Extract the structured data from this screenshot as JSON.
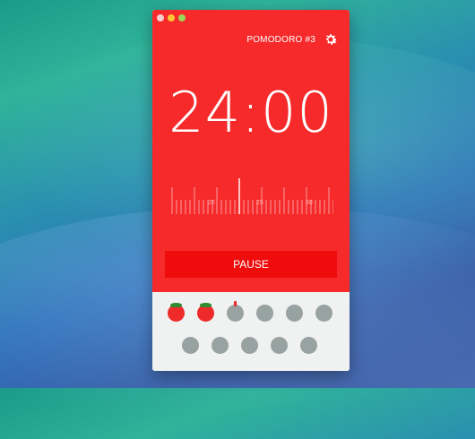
{
  "header": {
    "title": "POMODORO #3"
  },
  "timer": {
    "value": "24:00"
  },
  "ruler": {
    "labels": [
      "20",
      "25",
      "30"
    ]
  },
  "controls": {
    "pause_label": "PAUSE"
  },
  "pomodoros": {
    "row1": [
      "tomato",
      "tomato",
      "sprout",
      "empty",
      "empty",
      "empty"
    ],
    "row2": [
      "empty",
      "empty",
      "empty",
      "empty",
      "empty"
    ]
  },
  "colors": {
    "primary": "#f62a2a",
    "button": "#ee0c0c",
    "slot": "#98a2a0"
  }
}
